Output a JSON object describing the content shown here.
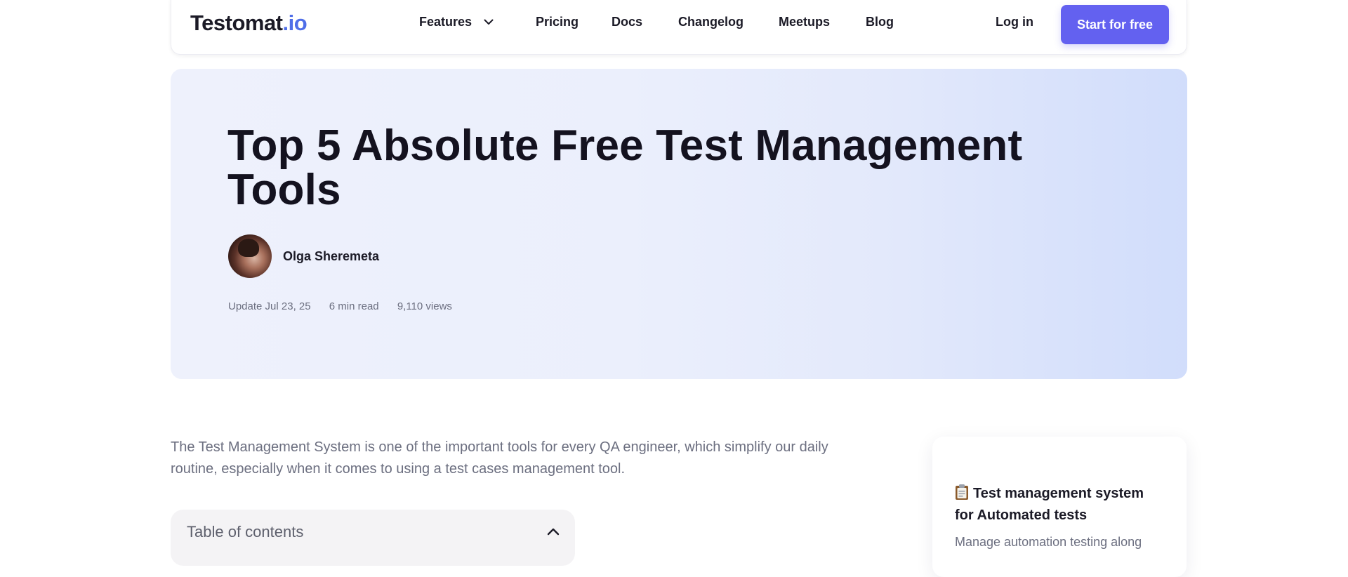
{
  "header": {
    "logo_main": "Testomat",
    "logo_suffix": ".io",
    "nav": {
      "features": "Features",
      "pricing": "Pricing",
      "docs": "Docs",
      "changelog": "Changelog",
      "meetups": "Meetups",
      "blog": "Blog"
    },
    "login": "Log in",
    "cta": "Start for free"
  },
  "article": {
    "title": "Top 5 Absolute Free Test Management Tools",
    "author": "Olga Sheremeta",
    "updated": "Update Jul 23, 25",
    "read_time": "6 min read",
    "views": "9,110 views",
    "intro": "The Test Management System is one of the important tools for every QA engineer, which simplify our daily routine, especially when it comes to using a test cases management tool."
  },
  "toc": {
    "title": "Table of contents"
  },
  "sidebar": {
    "card_title": "Test management system for Automated tests",
    "card_desc": "Manage automation testing along"
  },
  "colors": {
    "accent": "#6361f0",
    "logo_suffix": "#4f6ee8",
    "text_dark": "#14121f",
    "text_muted": "#6c6f80"
  }
}
